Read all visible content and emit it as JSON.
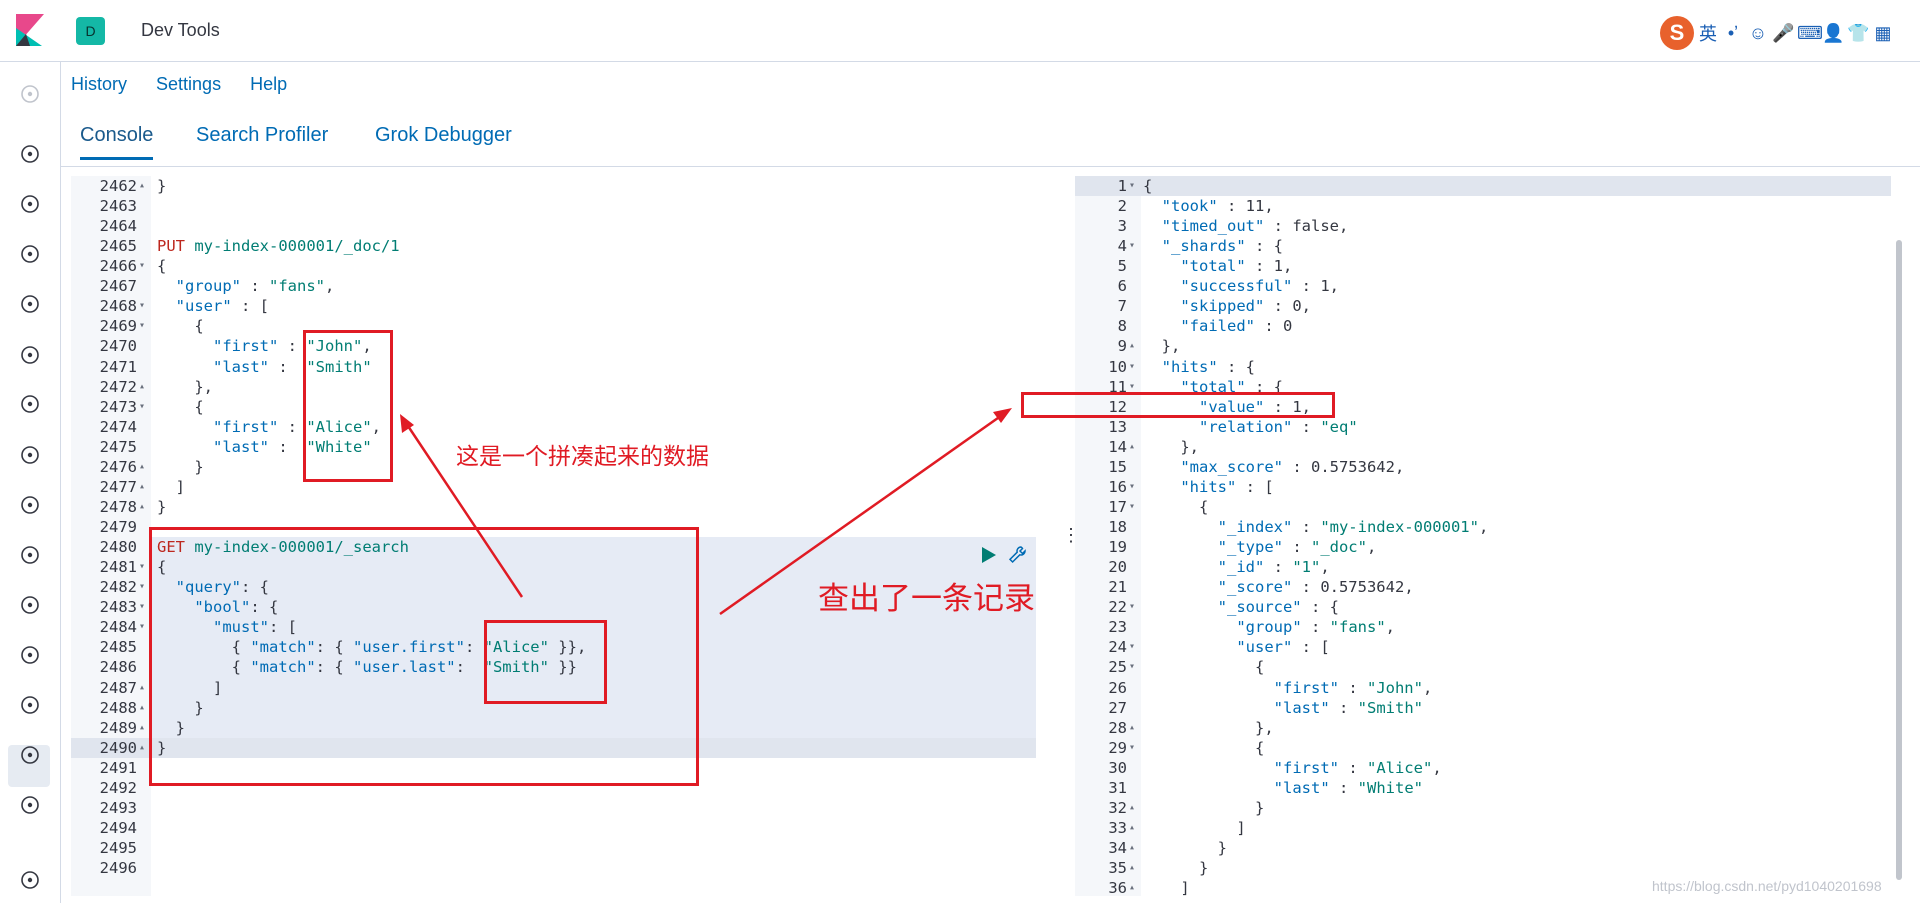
{
  "app": {
    "title": "Dev Tools",
    "badge": "D"
  },
  "ime": {
    "logo": "S",
    "lang": "英",
    "items": [
      "•ʼ",
      "☺",
      "🎤",
      "⌨",
      "👤",
      "👕",
      "▦"
    ]
  },
  "menu": {
    "history": "History",
    "settings": "Settings",
    "help": "Help"
  },
  "tabs": [
    {
      "label": "Console"
    },
    {
      "label": "Search Profiler"
    },
    {
      "label": "Grok Debugger"
    }
  ],
  "nav_icons": [
    "clock-icon",
    "compass-icon",
    "chart-icon",
    "dashboard-icon",
    "canvas-icon",
    "maps-icon",
    "ml-icon",
    "infra-icon",
    "logs-icon",
    "apm-icon",
    "uptime-icon",
    "security-icon",
    "devtools-icon",
    "monitoring-icon",
    "settings-icon",
    "collapse-icon"
  ],
  "request_lines": [
    {
      "n": "2462",
      "f": "▴",
      "t": "}"
    },
    {
      "n": "2463",
      "f": "",
      "t": ""
    },
    {
      "n": "2464",
      "f": "",
      "t": ""
    },
    {
      "n": "2465",
      "f": "",
      "t": "PUT my-index-000001/_doc/1"
    },
    {
      "n": "2466",
      "f": "▾",
      "t": "{"
    },
    {
      "n": "2467",
      "f": "",
      "t": "  \"group\" : \"fans\","
    },
    {
      "n": "2468",
      "f": "▾",
      "t": "  \"user\" : ["
    },
    {
      "n": "2469",
      "f": "▾",
      "t": "    {"
    },
    {
      "n": "2470",
      "f": "",
      "t": "      \"first\" : \"John\","
    },
    {
      "n": "2471",
      "f": "",
      "t": "      \"last\" :  \"Smith\""
    },
    {
      "n": "2472",
      "f": "▴",
      "t": "    },"
    },
    {
      "n": "2473",
      "f": "▾",
      "t": "    {"
    },
    {
      "n": "2474",
      "f": "",
      "t": "      \"first\" : \"Alice\","
    },
    {
      "n": "2475",
      "f": "",
      "t": "      \"last\" :  \"White\""
    },
    {
      "n": "2476",
      "f": "▴",
      "t": "    }"
    },
    {
      "n": "2477",
      "f": "▴",
      "t": "  ]"
    },
    {
      "n": "2478",
      "f": "▴",
      "t": "}"
    },
    {
      "n": "2479",
      "f": "",
      "t": ""
    },
    {
      "n": "2480",
      "f": "",
      "t": "GET my-index-000001/_search"
    },
    {
      "n": "2481",
      "f": "▾",
      "t": "{"
    },
    {
      "n": "2482",
      "f": "▾",
      "t": "  \"query\": {"
    },
    {
      "n": "2483",
      "f": "▾",
      "t": "    \"bool\": {"
    },
    {
      "n": "2484",
      "f": "▾",
      "t": "      \"must\": ["
    },
    {
      "n": "2485",
      "f": "",
      "t": "        { \"match\": { \"user.first\": \"Alice\" }},"
    },
    {
      "n": "2486",
      "f": "",
      "t": "        { \"match\": { \"user.last\":  \"Smith\" }}"
    },
    {
      "n": "2487",
      "f": "▴",
      "t": "      ]"
    },
    {
      "n": "2488",
      "f": "▴",
      "t": "    }"
    },
    {
      "n": "2489",
      "f": "▴",
      "t": "  }"
    },
    {
      "n": "2490",
      "f": "▴",
      "t": "}"
    },
    {
      "n": "2491",
      "f": "",
      "t": ""
    },
    {
      "n": "2492",
      "f": "",
      "t": ""
    },
    {
      "n": "2493",
      "f": "",
      "t": ""
    },
    {
      "n": "2494",
      "f": "",
      "t": ""
    },
    {
      "n": "2495",
      "f": "",
      "t": ""
    },
    {
      "n": "2496",
      "f": "",
      "t": ""
    }
  ],
  "response_lines": [
    {
      "n": "1",
      "f": "▾",
      "t": "{"
    },
    {
      "n": "2",
      "f": "",
      "t": "  \"took\" : 11,"
    },
    {
      "n": "3",
      "f": "",
      "t": "  \"timed_out\" : false,"
    },
    {
      "n": "4",
      "f": "▾",
      "t": "  \"_shards\" : {"
    },
    {
      "n": "5",
      "f": "",
      "t": "    \"total\" : 1,"
    },
    {
      "n": "6",
      "f": "",
      "t": "    \"successful\" : 1,"
    },
    {
      "n": "7",
      "f": "",
      "t": "    \"skipped\" : 0,"
    },
    {
      "n": "8",
      "f": "",
      "t": "    \"failed\" : 0"
    },
    {
      "n": "9",
      "f": "▴",
      "t": "  },"
    },
    {
      "n": "10",
      "f": "▾",
      "t": "  \"hits\" : {"
    },
    {
      "n": "11",
      "f": "▾",
      "t": "    \"total\" : {"
    },
    {
      "n": "12",
      "f": "",
      "t": "      \"value\" : 1,"
    },
    {
      "n": "13",
      "f": "",
      "t": "      \"relation\" : \"eq\""
    },
    {
      "n": "14",
      "f": "▴",
      "t": "    },"
    },
    {
      "n": "15",
      "f": "",
      "t": "    \"max_score\" : 0.5753642,"
    },
    {
      "n": "16",
      "f": "▾",
      "t": "    \"hits\" : ["
    },
    {
      "n": "17",
      "f": "▾",
      "t": "      {"
    },
    {
      "n": "18",
      "f": "",
      "t": "        \"_index\" : \"my-index-000001\","
    },
    {
      "n": "19",
      "f": "",
      "t": "        \"_type\" : \"_doc\","
    },
    {
      "n": "20",
      "f": "",
      "t": "        \"_id\" : \"1\","
    },
    {
      "n": "21",
      "f": "",
      "t": "        \"_score\" : 0.5753642,"
    },
    {
      "n": "22",
      "f": "▾",
      "t": "        \"_source\" : {"
    },
    {
      "n": "23",
      "f": "",
      "t": "          \"group\" : \"fans\","
    },
    {
      "n": "24",
      "f": "▾",
      "t": "          \"user\" : ["
    },
    {
      "n": "25",
      "f": "▾",
      "t": "            {"
    },
    {
      "n": "26",
      "f": "",
      "t": "              \"first\" : \"John\","
    },
    {
      "n": "27",
      "f": "",
      "t": "              \"last\" : \"Smith\""
    },
    {
      "n": "28",
      "f": "▴",
      "t": "            },"
    },
    {
      "n": "29",
      "f": "▾",
      "t": "            {"
    },
    {
      "n": "30",
      "f": "",
      "t": "              \"first\" : \"Alice\","
    },
    {
      "n": "31",
      "f": "",
      "t": "              \"last\" : \"White\""
    },
    {
      "n": "32",
      "f": "▴",
      "t": "            }"
    },
    {
      "n": "33",
      "f": "▴",
      "t": "          ]"
    },
    {
      "n": "34",
      "f": "▴",
      "t": "        }"
    },
    {
      "n": "35",
      "f": "▴",
      "t": "      }"
    },
    {
      "n": "36",
      "f": "▴",
      "t": "    ]"
    }
  ],
  "annotations": {
    "note_left": "这是一个拼凑起来的数据",
    "note_right": "查出了一条记录"
  },
  "watermark": "https://blog.csdn.net/pyd1040201698",
  "colors": {
    "accent": "#006bb4",
    "annotation": "#e01b24",
    "badge": "#14b8a6"
  }
}
